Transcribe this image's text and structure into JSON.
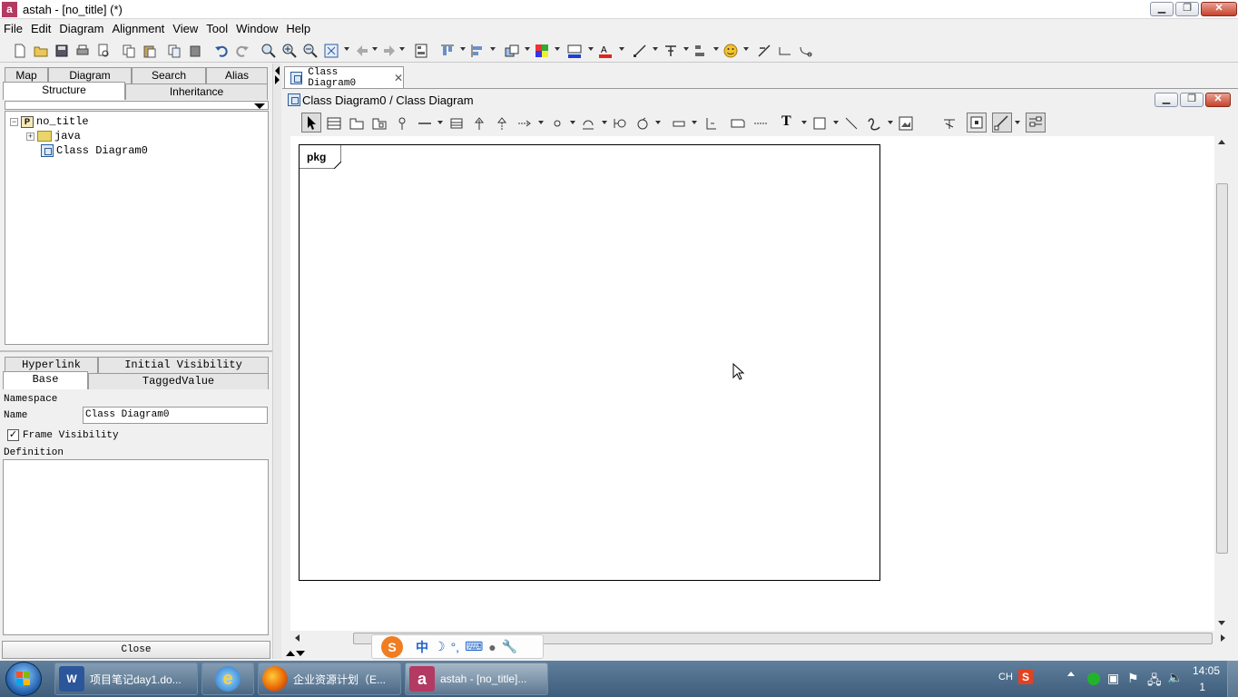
{
  "window": {
    "title": "astah - [no_title] (*)",
    "app_icon_text": "a"
  },
  "menubar": {
    "items": [
      "File",
      "Edit",
      "Diagram",
      "Alignment",
      "View",
      "Tool",
      "Window",
      "Help"
    ]
  },
  "left_panel": {
    "top_tabs_back": [
      "Map",
      "Diagram",
      "Search",
      "Alias"
    ],
    "top_tabs_front": [
      "Structure",
      "Inheritance"
    ],
    "active_top_tab": "Structure",
    "tree": {
      "root": "no_title",
      "root_icon_letter": "P",
      "children": [
        "java",
        "Class Diagram0"
      ]
    },
    "prop_tabs_back": [
      "Hyperlink",
      "Initial Visibility"
    ],
    "prop_tabs_front": [
      "Base",
      "TaggedValue"
    ],
    "active_prop_tab": "Base",
    "properties": {
      "namespace_label": "Namespace",
      "name_label": "Name",
      "name_value": "Class Diagram0",
      "frame_visibility_label": "Frame Visibility",
      "frame_visibility_checked": true,
      "definition_label": "Definition"
    },
    "close_button": "Close"
  },
  "editor": {
    "tab_label": "Class Diagram0",
    "inner_title": "Class Diagram0 / Class Diagram",
    "frame_label": "pkg"
  },
  "ime_bar": {
    "mode": "中"
  },
  "taskbar": {
    "tasks": [
      {
        "label": "项目笔记day1.do...",
        "icon": "word-icon",
        "color": "#2b579a"
      },
      {
        "label": "",
        "icon": "ie-icon",
        "color": "#2f8fde"
      },
      {
        "label": "企业资源计划（E...",
        "icon": "firefox-icon",
        "color": "#e66000"
      },
      {
        "label": "astah - [no_title]...",
        "icon": "astah-icon",
        "color": "#b33a62"
      }
    ],
    "tray": {
      "ime": "CH",
      "time": "14:05",
      "date": "1"
    }
  },
  "colors": {
    "astah_brand": "#b33a62",
    "taskbar": "#4a6a89",
    "close_button": "#c7432c"
  }
}
